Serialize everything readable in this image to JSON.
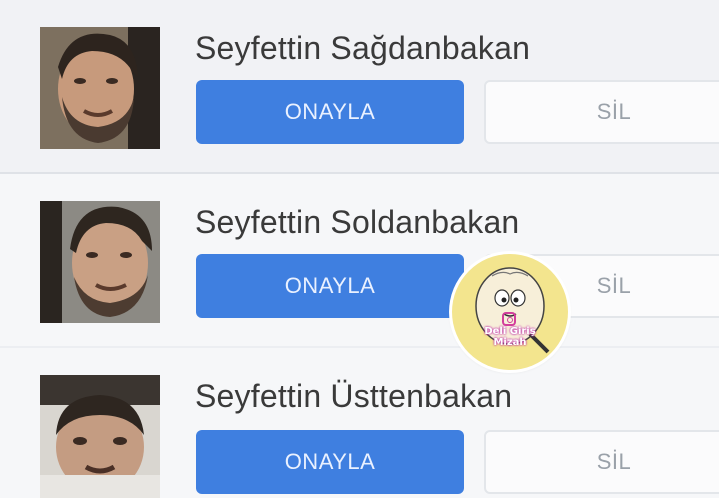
{
  "requests": [
    {
      "name": "Seyfettin Sağdanbakan",
      "approve_label": "ONAYLA",
      "delete_label": "SİL"
    },
    {
      "name": "Seyfettin Soldanbakan",
      "approve_label": "ONAYLA",
      "delete_label": "SİL"
    },
    {
      "name": "Seyfettin Üsttenbakan",
      "approve_label": "ONAYLA",
      "delete_label": "SİL"
    }
  ],
  "watermark": {
    "text": "Deli Giriş Mizah"
  },
  "colors": {
    "approve": "#3f7fe0",
    "delete_text": "#9aa1a9",
    "background": "#eceef2"
  }
}
